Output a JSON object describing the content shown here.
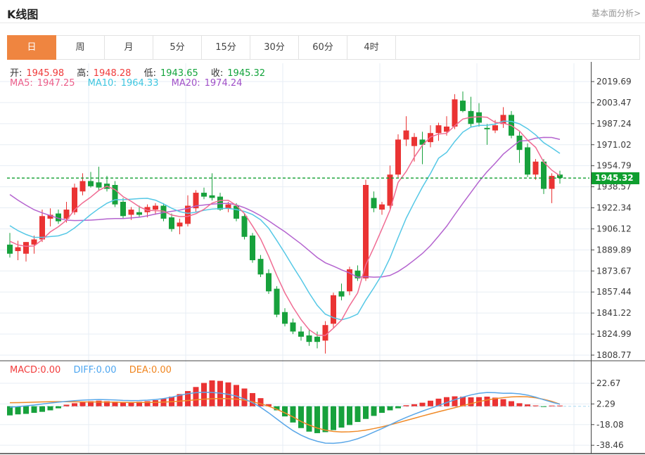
{
  "header": {
    "title": "K线图",
    "link": "基本面分析>"
  },
  "tabs": {
    "items": [
      {
        "label": "日",
        "selected": true
      },
      {
        "label": "周",
        "selected": false
      },
      {
        "label": "月",
        "selected": false
      },
      {
        "label": "5分",
        "selected": false
      },
      {
        "label": "15分",
        "selected": false
      },
      {
        "label": "30分",
        "selected": false
      },
      {
        "label": "60分",
        "selected": false
      },
      {
        "label": "4时",
        "selected": false
      }
    ]
  },
  "legend": {
    "open_label": "开:",
    "open": "1945.98",
    "high_label": "高:",
    "high": "1948.28",
    "low_label": "低:",
    "low": "1943.65",
    "close_label": "收:",
    "close": "1945.32",
    "ma5_label": "MA5:",
    "ma5": "1947.25",
    "ma10_label": "MA10:",
    "ma10": "1964.33",
    "ma20_label": "MA20:",
    "ma20": "1974.24"
  },
  "macd_legend": {
    "macd": "MACD:0.00",
    "diff": "DIFF:0.00",
    "dea": "DEA:0.00"
  },
  "price_tag": "1945.32",
  "colors": {
    "up": "#ea3333",
    "down": "#17a13c",
    "tab_selected": "#ef8540",
    "ma5": "#f06c93",
    "ma10": "#55c8e6",
    "ma20": "#b464cf",
    "diff_line": "#5aa7e8",
    "dea_line": "#f08a28",
    "price_line": "#0f9f2f",
    "grid": "#e7edf4",
    "axis": "#444444",
    "macd_zero_dash": "#a8d8f0"
  },
  "chart_data": [
    {
      "type": "candlestick",
      "title": "K线图 日线",
      "y_ticks": [
        2019.69,
        2003.47,
        1987.24,
        1971.02,
        1954.79,
        1938.57,
        1922.34,
        1906.12,
        1889.89,
        1873.67,
        1857.44,
        1841.22,
        1824.99,
        1808.77
      ],
      "price_line": 1945.32,
      "ohlc_readout": {
        "open": 1945.98,
        "high": 1948.28,
        "low": 1943.65,
        "close": 1945.32
      },
      "ma_readout": {
        "ma5": 1947.25,
        "ma10": 1964.33,
        "ma20": 1974.24
      },
      "candles": [
        [
          1894,
          1903,
          1884,
          1887
        ],
        [
          1889,
          1897,
          1882,
          1892
        ],
        [
          1887,
          1896,
          1881,
          1896
        ],
        [
          1894,
          1901,
          1887,
          1898
        ],
        [
          1898,
          1921,
          1896,
          1916
        ],
        [
          1914,
          1922,
          1908,
          1917
        ],
        [
          1918,
          1921,
          1910,
          1912
        ],
        [
          1914,
          1927,
          1911,
          1921
        ],
        [
          1919,
          1941,
          1917,
          1938
        ],
        [
          1935,
          1949,
          1932,
          1943
        ],
        [
          1943,
          1950,
          1938,
          1939
        ],
        [
          1942,
          1954,
          1936,
          1938
        ],
        [
          1941,
          1947,
          1935,
          1937
        ],
        [
          1940,
          1943,
          1923,
          1925
        ],
        [
          1927,
          1930,
          1914,
          1916
        ],
        [
          1917,
          1923,
          1913,
          1921
        ],
        [
          1919,
          1924,
          1915,
          1917
        ],
        [
          1919,
          1925,
          1915,
          1923
        ],
        [
          1921,
          1926,
          1917,
          1924
        ],
        [
          1924,
          1926,
          1912,
          1914
        ],
        [
          1915,
          1918,
          1904,
          1906
        ],
        [
          1908,
          1914,
          1902,
          1911
        ],
        [
          1910,
          1932,
          1908,
          1924
        ],
        [
          1922,
          1936,
          1919,
          1934
        ],
        [
          1934,
          1938,
          1929,
          1931
        ],
        [
          1932,
          1949,
          1928,
          1930
        ],
        [
          1931,
          1934,
          1920,
          1921
        ],
        [
          1922,
          1927,
          1919,
          1925
        ],
        [
          1924,
          1926,
          1912,
          1914
        ],
        [
          1916,
          1918,
          1898,
          1900
        ],
        [
          1901,
          1903,
          1880,
          1882
        ],
        [
          1883,
          1886,
          1869,
          1871
        ],
        [
          1872,
          1875,
          1856,
          1858
        ],
        [
          1860,
          1862,
          1838,
          1840
        ],
        [
          1842,
          1845,
          1831,
          1833
        ],
        [
          1834,
          1837,
          1825,
          1827
        ],
        [
          1827,
          1831,
          1820,
          1823
        ],
        [
          1824,
          1829,
          1816,
          1819
        ],
        [
          1823,
          1827,
          1814,
          1819
        ],
        [
          1820,
          1835,
          1810,
          1832
        ],
        [
          1833,
          1857,
          1830,
          1855
        ],
        [
          1858,
          1864,
          1851,
          1854
        ],
        [
          1858,
          1877,
          1855,
          1875
        ],
        [
          1874,
          1878,
          1866,
          1868
        ],
        [
          1868,
          1944,
          1866,
          1940
        ],
        [
          1930,
          1935,
          1919,
          1922
        ],
        [
          1921,
          1927,
          1917,
          1925
        ],
        [
          1924,
          1955,
          1921,
          1948
        ],
        [
          1948,
          1979,
          1945,
          1975
        ],
        [
          1975,
          1993,
          1970,
          1982
        ],
        [
          1970,
          1980,
          1958,
          1977
        ],
        [
          1975,
          1981,
          1956,
          1971
        ],
        [
          1973,
          1986,
          1969,
          1980
        ],
        [
          1980,
          1988,
          1974,
          1986
        ],
        [
          1981,
          1993,
          1978,
          1985
        ],
        [
          1985,
          2010,
          1983,
          2006
        ],
        [
          2005,
          2012,
          1996,
          1997
        ],
        [
          1997,
          2008,
          1985,
          1987
        ],
        [
          1996,
          2003,
          1985,
          1988
        ],
        [
          1984,
          1987,
          1971,
          1983
        ],
        [
          1982,
          1990,
          1980,
          1986
        ],
        [
          1987,
          2000,
          1984,
          1994
        ],
        [
          1994,
          1997,
          1976,
          1978
        ],
        [
          1978,
          1981,
          1957,
          1967
        ],
        [
          1969,
          1972,
          1946,
          1948
        ],
        [
          1948,
          1960,
          1944,
          1958
        ],
        [
          1958,
          1960,
          1933,
          1937
        ],
        [
          1937,
          1949,
          1926,
          1947
        ],
        [
          1948,
          1951,
          1941,
          1945.32
        ]
      ],
      "ma_periods": [
        5,
        10,
        20
      ]
    },
    {
      "type": "bar",
      "name": "MACD",
      "y_ticks": [
        22.67,
        2.29,
        -18.08,
        -38.46
      ],
      "readout": {
        "macd": 0.0,
        "diff": 0.0,
        "dea": 0.0
      },
      "histogram": [
        -9,
        -8,
        -7.5,
        -6.5,
        -5.5,
        -4,
        -2,
        1.5,
        3,
        4.5,
        5,
        5.5,
        5,
        4.5,
        4,
        4,
        4.5,
        5,
        6,
        7.5,
        9.5,
        12,
        15,
        19,
        23,
        25.5,
        25,
        23.5,
        21,
        17.5,
        13,
        8,
        2,
        -4,
        -10,
        -16,
        -21.5,
        -25,
        -26.5,
        -25.5,
        -23.5,
        -21,
        -18.5,
        -15.5,
        -12.5,
        -9.5,
        -6.5,
        -4,
        -2,
        1,
        2,
        3.5,
        5.5,
        7.5,
        9,
        9.8,
        9.4,
        8.8,
        9,
        9.5,
        8.5,
        7,
        5,
        3,
        1.8,
        0.8,
        -0.3,
        0.3,
        0.1
      ],
      "diff": [
        -1,
        -0.3,
        0.4,
        1.2,
        2.2,
        3.2,
        4,
        4.8,
        5.5,
        6,
        6.4,
        6.6,
        6.5,
        6.2,
        5.8,
        5.6,
        5.7,
        6,
        6.6,
        7.6,
        9,
        10.8,
        12.4,
        13.4,
        13.8,
        13.6,
        13,
        11.8,
        10,
        7.2,
        3.5,
        -1,
        -6.5,
        -12.5,
        -18.5,
        -24,
        -28.5,
        -32,
        -34.5,
        -36.3,
        -36.5,
        -35.8,
        -34.3,
        -32,
        -29,
        -25.5,
        -22,
        -18.3,
        -14.5,
        -11,
        -7.8,
        -4.8,
        -2,
        0.8,
        3.6,
        6.4,
        9,
        11.2,
        12.8,
        13.6,
        13.4,
        12.8,
        12.9,
        12.3,
        11,
        9,
        6.4,
        4,
        2
      ],
      "dea": [
        3.5,
        3.6,
        3.8,
        4,
        4.3,
        4.5,
        4.6,
        4.5,
        4.4,
        4.3,
        4.2,
        4.2,
        4.1,
        4,
        3.9,
        3.8,
        3.8,
        3.8,
        3.9,
        4.1,
        4.5,
        5,
        5.7,
        6.4,
        7,
        7.4,
        7.6,
        7.5,
        7,
        6,
        4.5,
        2.5,
        0,
        -3,
        -6.5,
        -10.5,
        -15,
        -18.5,
        -21.5,
        -23.5,
        -24.8,
        -25.3,
        -25.2,
        -24.6,
        -23.5,
        -22,
        -20.3,
        -18.3,
        -16.2,
        -14,
        -11.8,
        -9.6,
        -7.5,
        -5.4,
        -3.4,
        -1.4,
        0.6,
        2.6,
        4.6,
        6.2,
        7.5,
        8.5,
        9.2,
        9.5,
        9.3,
        8.4,
        6.8,
        4.8,
        2.1
      ]
    }
  ]
}
